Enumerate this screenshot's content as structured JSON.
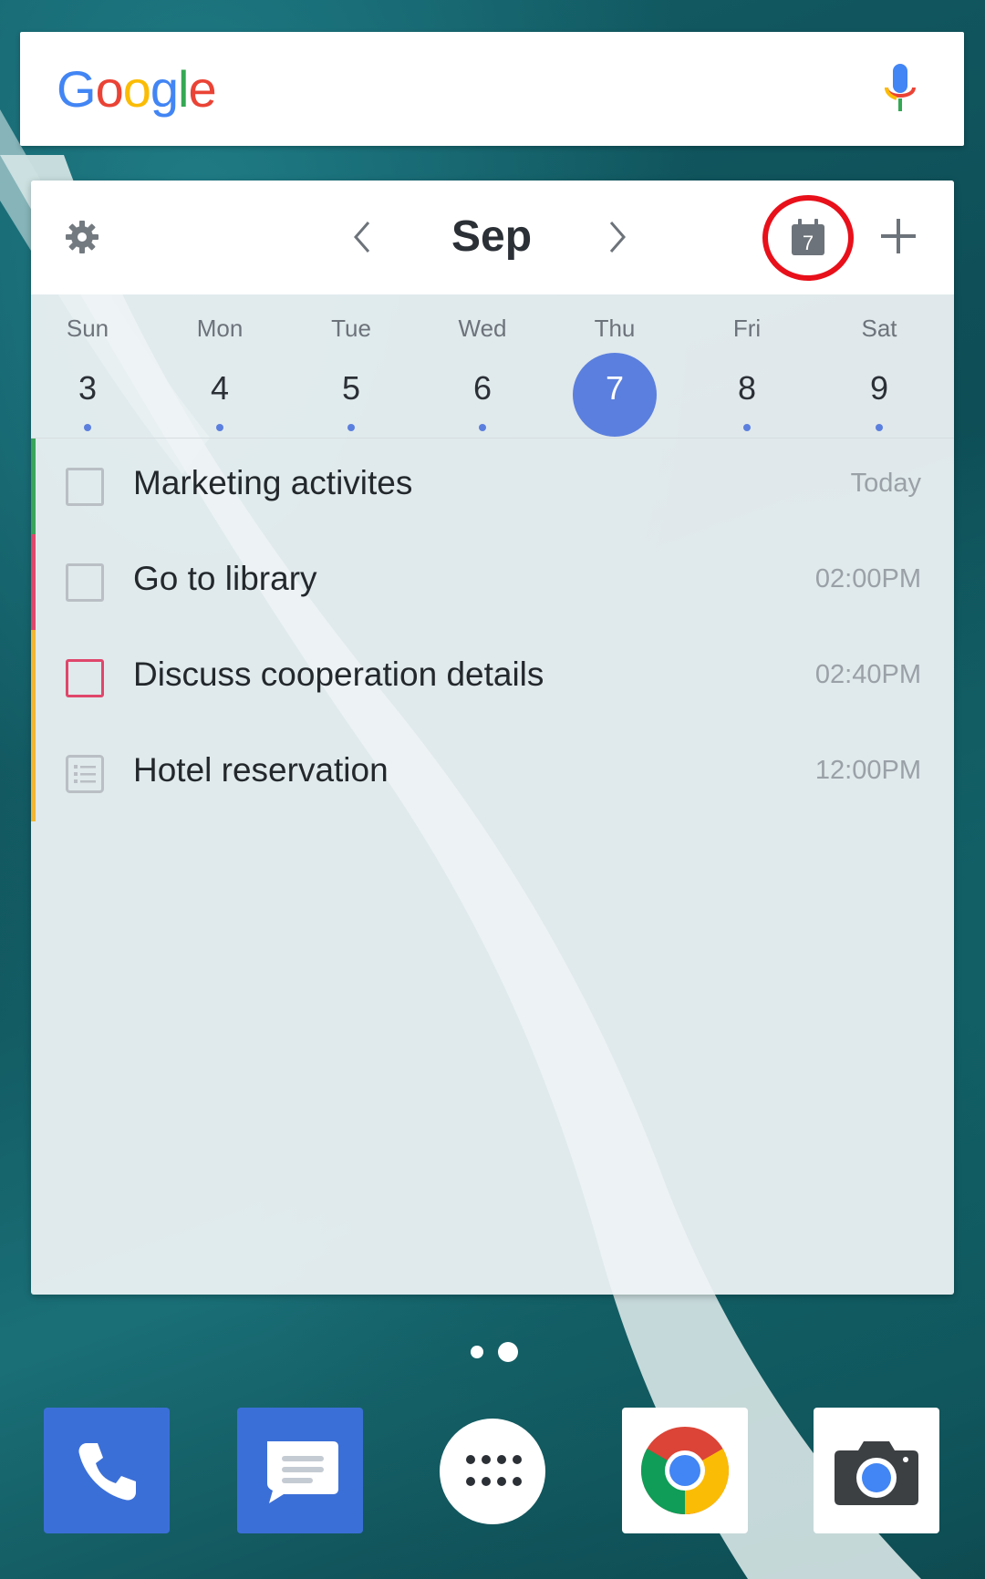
{
  "search": {
    "logo": [
      "G",
      "o",
      "o",
      "g",
      "l",
      "e"
    ],
    "mic_icon": "mic-icon"
  },
  "widget": {
    "month": "Sep",
    "today_badge": "7",
    "week": [
      {
        "name": "Sun",
        "num": "3"
      },
      {
        "name": "Mon",
        "num": "4"
      },
      {
        "name": "Tue",
        "num": "5"
      },
      {
        "name": "Wed",
        "num": "6"
      },
      {
        "name": "Thu",
        "num": "7"
      },
      {
        "name": "Fri",
        "num": "8"
      },
      {
        "name": "Sat",
        "num": "9"
      }
    ],
    "selected_day": "7",
    "tasks": [
      {
        "title": "Marketing activites",
        "time": "Today",
        "color": "#3aa55a",
        "icon": "checkbox"
      },
      {
        "title": "Go to library",
        "time": "02:00PM",
        "color": "#e0476b",
        "icon": "checkbox"
      },
      {
        "title": "Discuss cooperation details",
        "time": "02:40PM",
        "color": "#f2b632",
        "icon": "checkbox-red"
      },
      {
        "title": "Hotel reservation",
        "time": "12:00PM",
        "color": "#f2b632",
        "icon": "notes-icon"
      }
    ]
  },
  "dock": {
    "apps": [
      "phone-icon",
      "messages-icon",
      "app-drawer-icon",
      "chrome-icon",
      "camera-icon"
    ]
  },
  "colors": {
    "accent": "#5b7fde",
    "highlight_ring": "#e8101a"
  }
}
